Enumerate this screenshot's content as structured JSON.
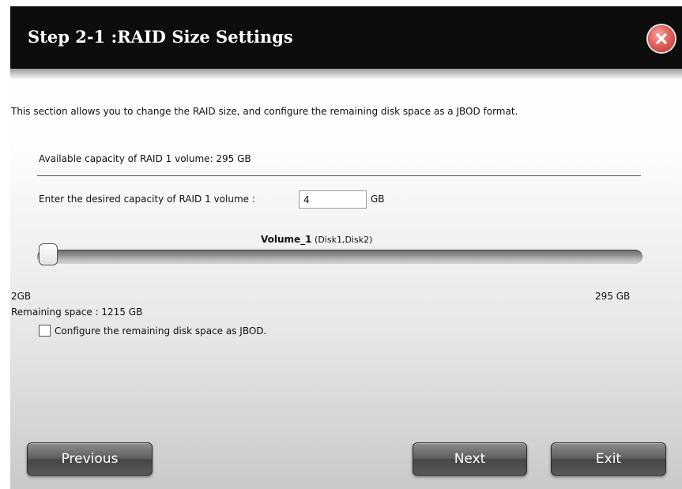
{
  "dialog": {
    "title": "Step 2-1 :RAID Size Settings",
    "description": "This section allows you to change the RAID size, and configure the remaining disk space as a JBOD format.",
    "available_capacity": "Available capacity of RAID 1 volume: 295 GB",
    "enter_capacity_label": "Enter the desired capacity of RAID 1 volume :",
    "capacity_value": "4",
    "capacity_unit": "GB",
    "volume_name": "Volume_1",
    "volume_disks": " (Disk1,Disk2)",
    "slider": {
      "min_label": "2GB",
      "max_label": "295 GB",
      "min": 2,
      "max": 295,
      "value": 4
    },
    "remaining_space": "Remaining space : 1215 GB",
    "jbod_label": "Configure the remaining disk space as JBOD.",
    "jbod_checked": false
  },
  "buttons": {
    "previous": "Previous",
    "next": "Next",
    "exit": "Exit"
  },
  "icons": {
    "close": "close-icon"
  },
  "colors": {
    "titlebar": "#0d0d0d",
    "close": "#d9534f",
    "button": "#5e5e5e"
  }
}
